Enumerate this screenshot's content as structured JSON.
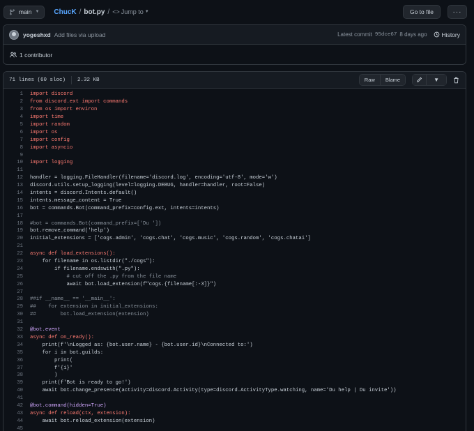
{
  "topbar": {
    "branch": "main",
    "repo": "ChucK",
    "separator": "/",
    "file": "bot.py",
    "jump_to": "Jump to",
    "goto_file": "Go to file",
    "more": "···"
  },
  "commit": {
    "author": "yogeshxd",
    "message": "Add files via upload",
    "latest_label": "Latest commit",
    "sha": "95dce67",
    "ago": "8 days ago",
    "history": "History",
    "contributors": "1 contributor"
  },
  "file": {
    "lines_info": "71 lines (60 sloc)",
    "size": "2.32 KB",
    "raw": "Raw",
    "blame": "Blame"
  },
  "code_lines": [
    {
      "n": "1",
      "t": "import discord",
      "c": "kw"
    },
    {
      "n": "2",
      "t": "from discord.ext import commands",
      "c": "kw"
    },
    {
      "n": "3",
      "t": "from os import environ",
      "c": "kw"
    },
    {
      "n": "4",
      "t": "import time",
      "c": "kw"
    },
    {
      "n": "5",
      "t": "import random",
      "c": "kw"
    },
    {
      "n": "6",
      "t": "import os",
      "c": "kw"
    },
    {
      "n": "7",
      "t": "import config",
      "c": "kw"
    },
    {
      "n": "8",
      "t": "import asyncio",
      "c": "kw"
    },
    {
      "n": "9",
      "t": "",
      "c": ""
    },
    {
      "n": "10",
      "t": "import logging",
      "c": "kw"
    },
    {
      "n": "11",
      "t": "",
      "c": ""
    },
    {
      "n": "12",
      "t": "handler = logging.FileHandler(filename='discord.log', encoding='utf-8', mode='w')",
      "c": ""
    },
    {
      "n": "13",
      "t": "discord.utils.setup_logging(level=logging.DEBUG, handler=handler, root=False)",
      "c": ""
    },
    {
      "n": "14",
      "t": "intents = discord.Intents.default()",
      "c": ""
    },
    {
      "n": "15",
      "t": "intents.message_content = True",
      "c": ""
    },
    {
      "n": "16",
      "t": "bot = commands.Bot(command_prefix=config.ext, intents=intents)",
      "c": ""
    },
    {
      "n": "17",
      "t": "",
      "c": ""
    },
    {
      "n": "18",
      "t": "#bot = commands.Bot(command_prefix=['Du '])",
      "c": "cm"
    },
    {
      "n": "19",
      "t": "bot.remove_command('help')",
      "c": ""
    },
    {
      "n": "20",
      "t": "initial_extensions = ['cogs.admin', 'cogs.chat', 'cogs.music', 'cogs.random', 'cogs.chatai']",
      "c": ""
    },
    {
      "n": "21",
      "t": "",
      "c": ""
    },
    {
      "n": "22",
      "t": "async def load_extensions():",
      "c": "kw"
    },
    {
      "n": "23",
      "t": "    for filename in os.listdir(\"./cogs\"):",
      "c": ""
    },
    {
      "n": "24",
      "t": "        if filename.endswith(\".py\"):",
      "c": ""
    },
    {
      "n": "25",
      "t": "            # cut off the .py from the file name",
      "c": "cm"
    },
    {
      "n": "26",
      "t": "            await bot.load_extension(f\"cogs.{filename[:-3]}\")",
      "c": ""
    },
    {
      "n": "27",
      "t": "",
      "c": ""
    },
    {
      "n": "28",
      "t": "##if __name__ == '__main__':",
      "c": "cm"
    },
    {
      "n": "29",
      "t": "##    for extension in initial_extensions:",
      "c": "cm"
    },
    {
      "n": "30",
      "t": "##        bot.load_extension(extension)",
      "c": "cm"
    },
    {
      "n": "31",
      "t": "",
      "c": ""
    },
    {
      "n": "32",
      "t": "@bot.event",
      "c": "dec"
    },
    {
      "n": "33",
      "t": "async def on_ready():",
      "c": "kw"
    },
    {
      "n": "34",
      "t": "    print(f'\\nLogged as: {bot.user.name} - {bot.user.id}\\nConnected to:')",
      "c": ""
    },
    {
      "n": "35",
      "t": "    for i in bot.guilds:",
      "c": ""
    },
    {
      "n": "36",
      "t": "        print(",
      "c": ""
    },
    {
      "n": "37",
      "t": "        f'{i}'",
      "c": ""
    },
    {
      "n": "38",
      "t": "        )",
      "c": ""
    },
    {
      "n": "39",
      "t": "    print(f'Bot is ready to go!')",
      "c": ""
    },
    {
      "n": "40",
      "t": "    await bot.change_presence(activity=discord.Activity(type=discord.ActivityType.watching, name='Du help | Du invite'))",
      "c": ""
    },
    {
      "n": "41",
      "t": "",
      "c": ""
    },
    {
      "n": "42",
      "t": "@bot.command(hidden=True)",
      "c": "dec"
    },
    {
      "n": "43",
      "t": "async def reload(ctx, extension):",
      "c": "kw"
    },
    {
      "n": "44",
      "t": "    await bot.reload_extension(extension)",
      "c": ""
    },
    {
      "n": "45",
      "t": "",
      "c": ""
    }
  ]
}
